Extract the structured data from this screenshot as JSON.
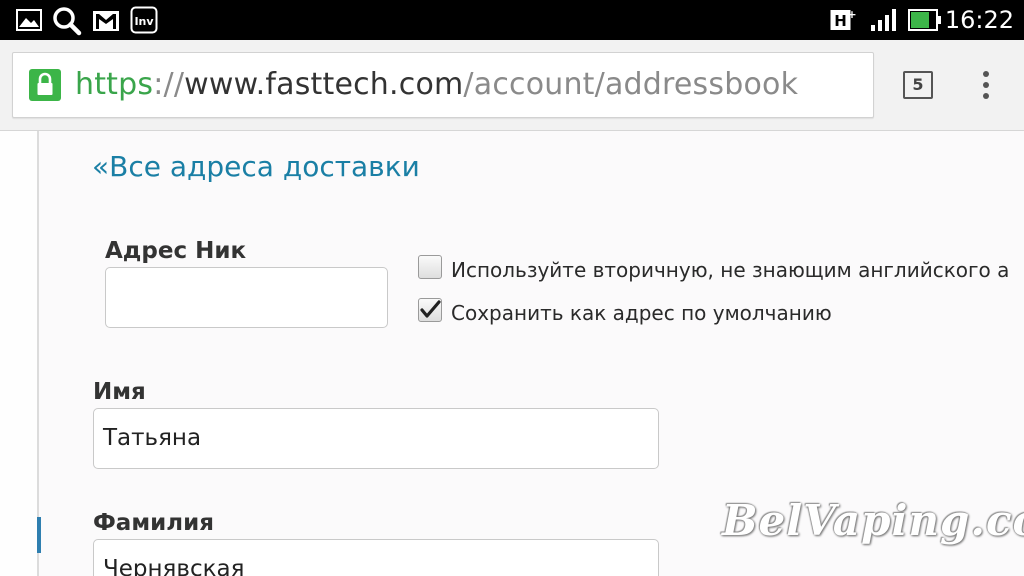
{
  "status_bar": {
    "icons": [
      "image-notification-icon",
      "search-icon",
      "gmail-icon",
      "inv-app-icon",
      "hplus-signal-icon",
      "signal-strength-icon",
      "battery-icon"
    ],
    "network_type": "H+",
    "time": "16:22",
    "battery_color": "#3cb548"
  },
  "browser": {
    "url_scheme": "https",
    "url_separator": "://",
    "url_host": "www.fasttech.com",
    "url_path": "/account/addressbook",
    "tab_count": "5",
    "secure_color": "#3aa54b"
  },
  "page": {
    "back_link": "«Все адреса доставки",
    "link_color": "#1a7fa5",
    "form": {
      "nickname_label": "Адрес Ник",
      "nickname_value": "",
      "secondary_language_checkbox": {
        "label": "Используйте вторичную, не знающим английского а",
        "checked": false
      },
      "default_address_checkbox": {
        "label": "Сохранить как адрес по умолчанию",
        "checked": true
      },
      "first_name_label": "Имя",
      "first_name_value": "Татьяна",
      "last_name_label": "Фамилия",
      "last_name_value": "Чернявская"
    }
  },
  "watermark": "BelVaping.com"
}
